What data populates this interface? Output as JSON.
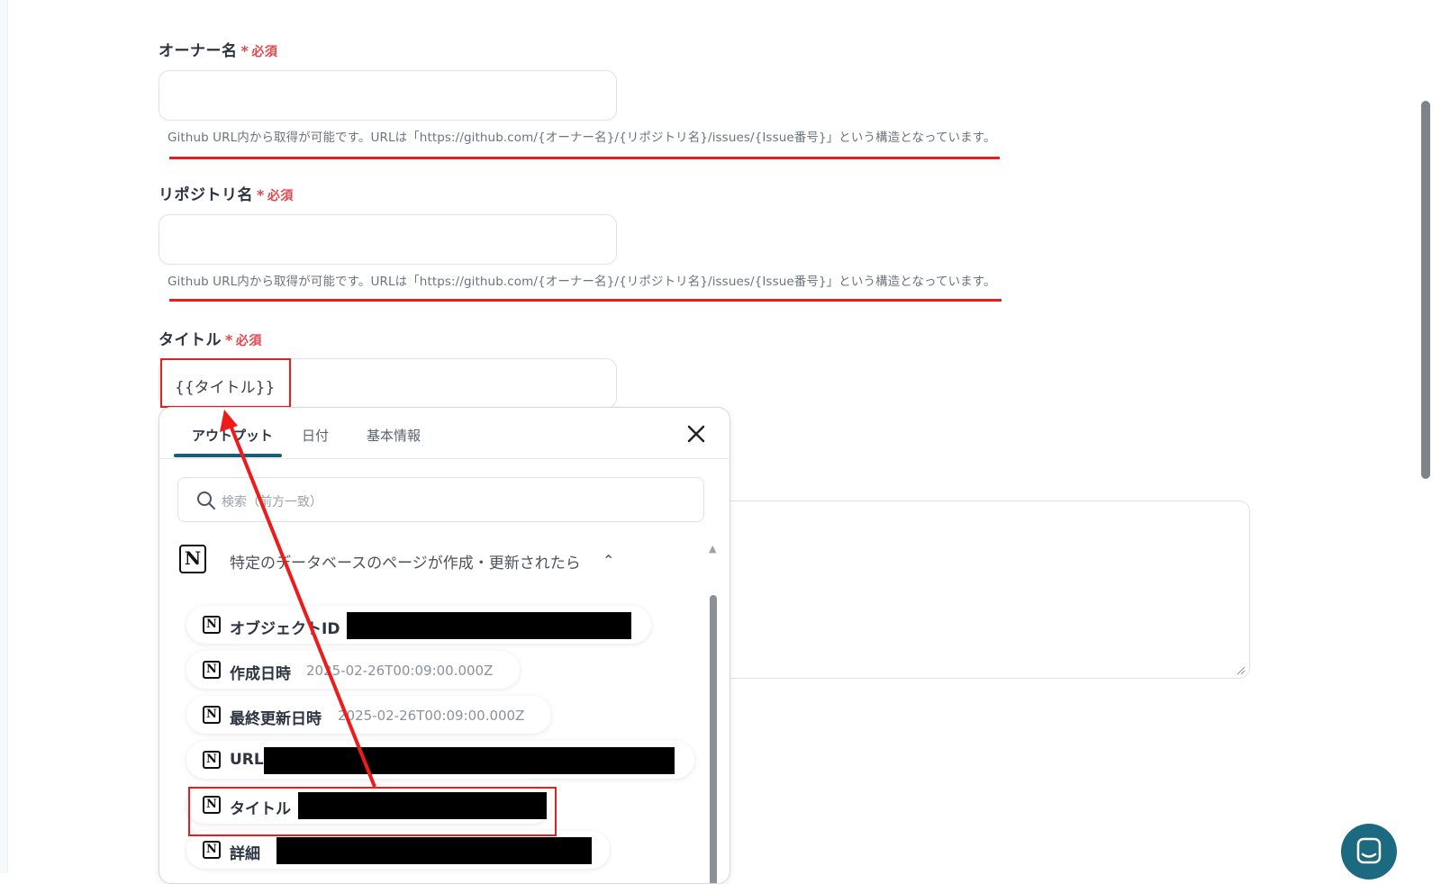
{
  "fields": {
    "owner": {
      "label": "オーナー名",
      "required_star": "*",
      "required_text": "必須",
      "value": "",
      "help": "Github URL内から取得が可能です。URLは「https://github.com/{オーナー名}/{リポジトリ名}/issues/{Issue番号}」という構造となっています。"
    },
    "repo": {
      "label": "リポジトリ名",
      "required_star": "*",
      "required_text": "必須",
      "value": "",
      "help": "Github URL内から取得が可能です。URLは「https://github.com/{オーナー名}/{リポジトリ名}/issues/{Issue番号}」という構造となっています。"
    },
    "title": {
      "label": "タイトル",
      "required_star": "*",
      "required_text": "必須",
      "value": "{{タイトル}}"
    }
  },
  "popup": {
    "tabs": [
      "アウトプット",
      "日付",
      "基本情報"
    ],
    "active_tab": "アウトプット",
    "search_placeholder": "検索（前方一致）",
    "group_title": "特定のデータベースのページが作成・更新されたら",
    "items": [
      {
        "name": "オブジェクトID",
        "value": ""
      },
      {
        "name": "作成日時",
        "value": "2025-02-26T00:09:00.000Z"
      },
      {
        "name": "最終更新日時",
        "value": "2025-02-26T00:09:00.000Z"
      },
      {
        "name": "URL",
        "value": ""
      },
      {
        "name": "タイトル",
        "value": ""
      },
      {
        "name": "詳細",
        "value": ""
      }
    ]
  },
  "icons": {
    "notion": "notion-icon",
    "close": "close-icon",
    "search": "search-icon",
    "chevron": "chevron-up-icon",
    "chat": "chat-icon"
  },
  "colors": {
    "required": "#e5484d",
    "annotation": "#ee1b1b",
    "accent": "#1d5e77",
    "chat_button": "#1b6a80"
  }
}
